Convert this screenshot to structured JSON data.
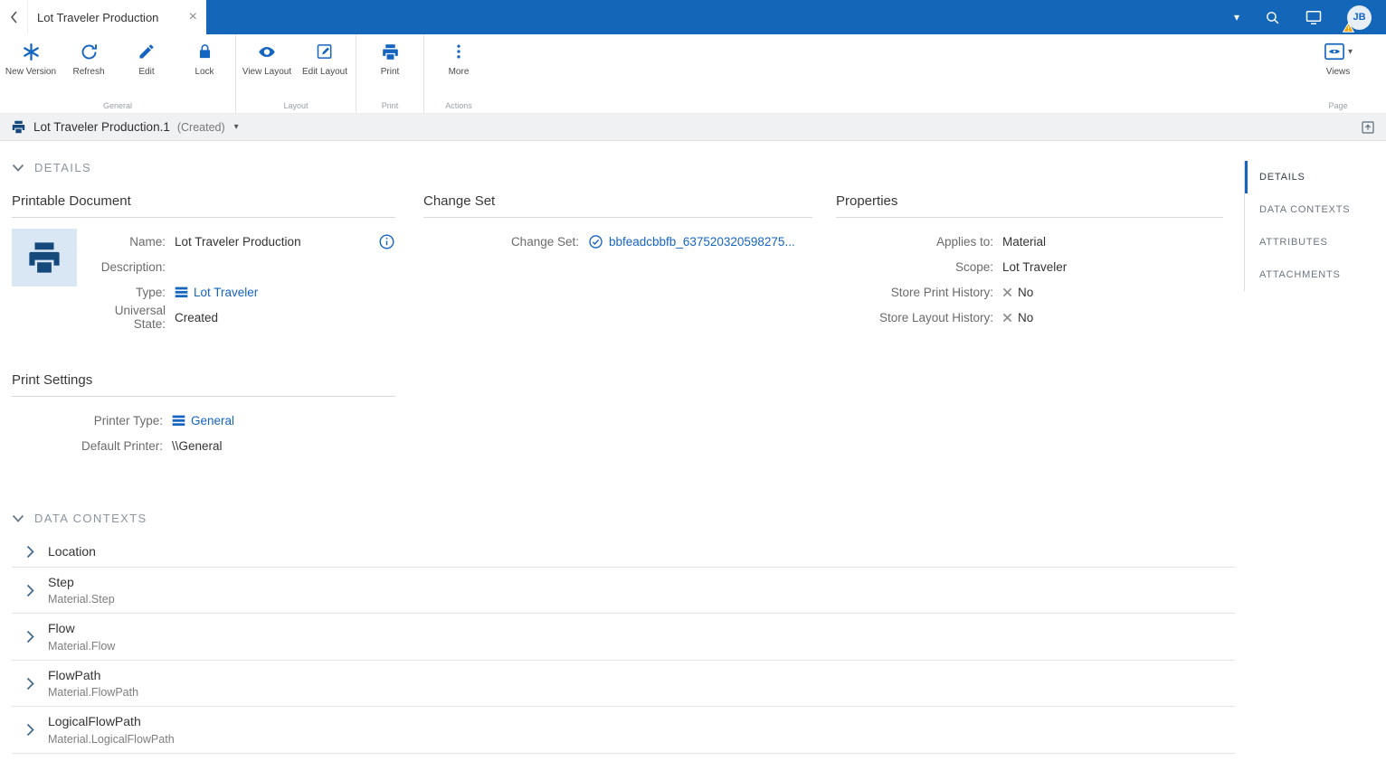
{
  "colors": {
    "accent": "#1565c0",
    "topbar": "#1467b8",
    "link": "#1565c0",
    "warning": "#f5a300",
    "thumb_bg": "#d9e7f4"
  },
  "topbar": {
    "tab_title": "Lot Traveler Production",
    "avatar_initials": "JB"
  },
  "toolbar": {
    "new_version": "New Version",
    "refresh": "Refresh",
    "edit": "Edit",
    "lock": "Lock",
    "view_layout": "View Layout",
    "edit_layout": "Edit Layout",
    "print": "Print",
    "more": "More",
    "views": "Views",
    "group_general": "General",
    "group_layout": "Layout",
    "group_print": "Print",
    "group_actions": "Actions",
    "group_page": "Page"
  },
  "docbar": {
    "title": "Lot Traveler Production.1",
    "state": "(Created)"
  },
  "right_nav": {
    "items": [
      {
        "label": "DETAILS",
        "active": true
      },
      {
        "label": "DATA CONTEXTS",
        "active": false
      },
      {
        "label": "ATTRIBUTES",
        "active": false
      },
      {
        "label": "ATTACHMENTS",
        "active": false
      }
    ]
  },
  "details": {
    "section_title": "DETAILS",
    "printable_document": {
      "title": "Printable Document",
      "name_label": "Name:",
      "name_value": "Lot Traveler Production",
      "description_label": "Description:",
      "description_value": "",
      "type_label": "Type:",
      "type_value": "Lot Traveler",
      "universal_state_label": "Universal State:",
      "universal_state_value": "Created"
    },
    "change_set": {
      "title": "Change Set",
      "label": "Change Set:",
      "value": "bbfeadcbbfb_637520320598275..."
    },
    "properties": {
      "title": "Properties",
      "applies_to_label": "Applies to:",
      "applies_to_value": "Material",
      "scope_label": "Scope:",
      "scope_value": "Lot Traveler",
      "store_print_history_label": "Store Print History:",
      "store_print_history_value": "No",
      "store_layout_history_label": "Store Layout History:",
      "store_layout_history_value": "No"
    },
    "print_settings": {
      "title": "Print Settings",
      "printer_type_label": "Printer Type:",
      "printer_type_value": "General",
      "default_printer_label": "Default Printer:",
      "default_printer_value": "\\\\General"
    }
  },
  "data_contexts": {
    "section_title": "DATA CONTEXTS",
    "rows": [
      {
        "name": "Location",
        "path": ""
      },
      {
        "name": "Step",
        "path": "Material.Step"
      },
      {
        "name": "Flow",
        "path": "Material.Flow"
      },
      {
        "name": "FlowPath",
        "path": "Material.FlowPath"
      },
      {
        "name": "LogicalFlowPath",
        "path": "Material.LogicalFlowPath"
      }
    ]
  }
}
